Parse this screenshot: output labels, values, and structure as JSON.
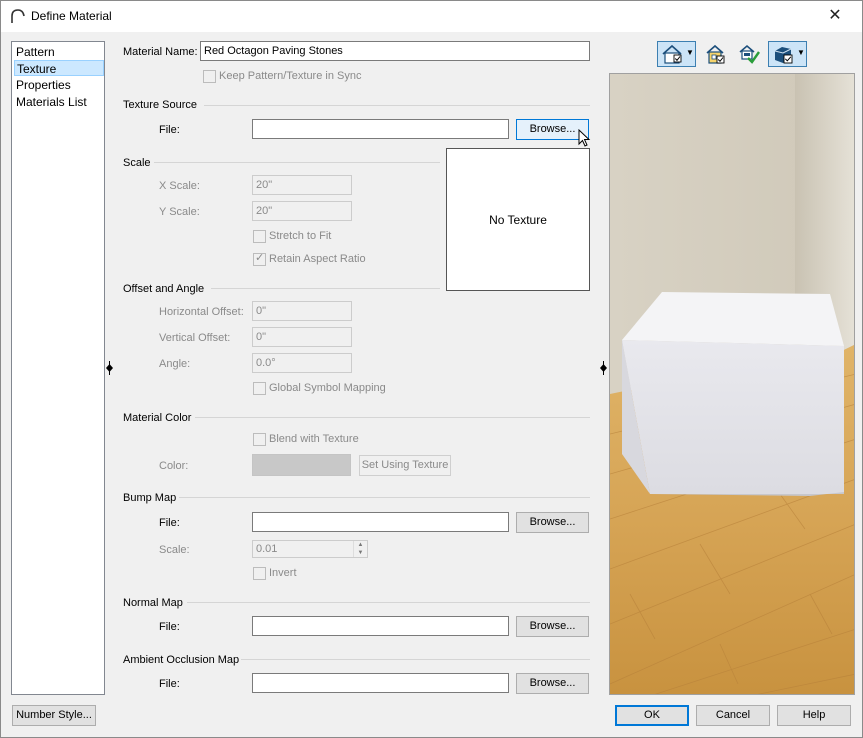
{
  "window": {
    "title": "Define Material",
    "close_glyph": "✕"
  },
  "nav": {
    "items": [
      {
        "label": "Pattern",
        "selected": false
      },
      {
        "label": "Texture",
        "selected": true
      },
      {
        "label": "Properties",
        "selected": false
      },
      {
        "label": "Materials List",
        "selected": false
      }
    ]
  },
  "material": {
    "name_label": "Material Name:",
    "name_value": "Red Octagon Paving Stones",
    "keep_sync_label": "Keep Pattern/Texture in Sync",
    "keep_sync_checked": false
  },
  "texture_source": {
    "section": "Texture Source",
    "file_label": "File:",
    "file_value": "",
    "browse_label": "Browse..."
  },
  "preview": {
    "text": "No Texture"
  },
  "scale": {
    "section": "Scale",
    "x_label": "X Scale:",
    "x_value": "20\"",
    "y_label": "Y Scale:",
    "y_value": "20\"",
    "stretch_label": "Stretch to Fit",
    "stretch_checked": false,
    "aspect_label": "Retain Aspect Ratio",
    "aspect_checked": true
  },
  "offset": {
    "section": "Offset and Angle",
    "h_label": "Horizontal Offset:",
    "h_value": "0\"",
    "v_label": "Vertical Offset:",
    "v_value": "0\"",
    "angle_label": "Angle:",
    "angle_value": "0.0°",
    "global_label": "Global Symbol Mapping",
    "global_checked": false
  },
  "material_color": {
    "section": "Material Color",
    "blend_label": "Blend with Texture",
    "blend_checked": false,
    "color_label": "Color:",
    "color_swatch": "#c8c8c8",
    "set_using_label": "Set Using Texture"
  },
  "bump_map": {
    "section": "Bump Map",
    "file_label": "File:",
    "file_value": "",
    "browse_label": "Browse...",
    "scale_label": "Scale:",
    "scale_value": "0.01",
    "invert_label": "Invert",
    "invert_checked": false
  },
  "normal_map": {
    "section": "Normal Map",
    "file_label": "File:",
    "file_value": "",
    "browse_label": "Browse..."
  },
  "ao_map": {
    "section": "Ambient Occlusion Map",
    "file_label": "File:",
    "file_value": "",
    "browse_label": "Browse..."
  },
  "footer": {
    "number_style_label": "Number Style...",
    "ok_label": "OK",
    "cancel_label": "Cancel",
    "help_label": "Help"
  },
  "toolbar": {
    "icons": [
      "house-view-icon",
      "dropdown-arrow-icon",
      "room-view-icon",
      "material-check-icon",
      "box-view-icon",
      "dropdown-arrow-icon"
    ]
  },
  "colors": {
    "accent": "#0078d7",
    "selection": "#cce8ff",
    "floor": "#d9a85a",
    "wall": "#dcd6ca",
    "cube": "#e6e6ea"
  }
}
